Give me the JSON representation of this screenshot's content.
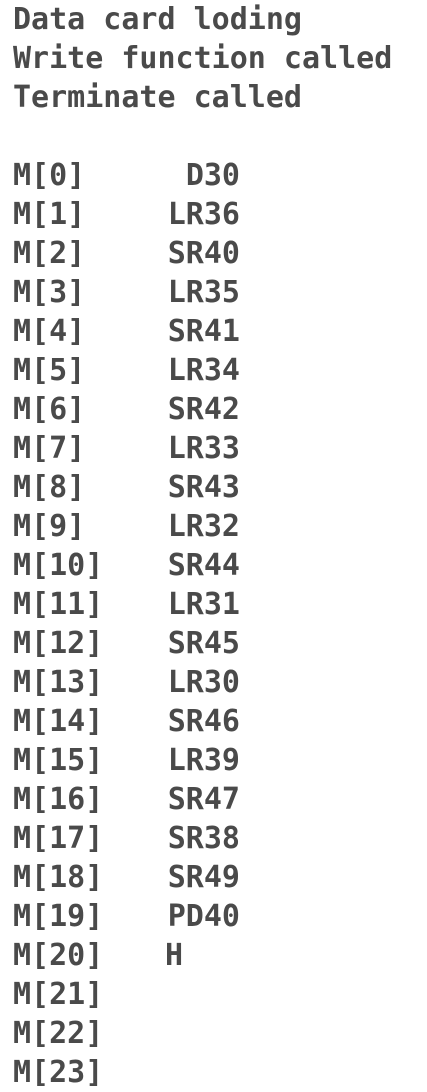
{
  "messages": [
    "Data card loding",
    "Write function called",
    "Terminate called"
  ],
  "memory": [
    {
      "addr": "M[0]",
      "value": "D30"
    },
    {
      "addr": "M[1]",
      "value": "LR36"
    },
    {
      "addr": "M[2]",
      "value": "SR40"
    },
    {
      "addr": "M[3]",
      "value": "LR35"
    },
    {
      "addr": "M[4]",
      "value": "SR41"
    },
    {
      "addr": "M[5]",
      "value": "LR34"
    },
    {
      "addr": "M[6]",
      "value": "SR42"
    },
    {
      "addr": "M[7]",
      "value": "LR33"
    },
    {
      "addr": "M[8]",
      "value": "SR43"
    },
    {
      "addr": "M[9]",
      "value": "LR32"
    },
    {
      "addr": "M[10]",
      "value": "SR44"
    },
    {
      "addr": "M[11]",
      "value": "LR31"
    },
    {
      "addr": "M[12]",
      "value": "SR45"
    },
    {
      "addr": "M[13]",
      "value": "LR30"
    },
    {
      "addr": "M[14]",
      "value": "SR46"
    },
    {
      "addr": "M[15]",
      "value": "LR39"
    },
    {
      "addr": "M[16]",
      "value": "SR47"
    },
    {
      "addr": "M[17]",
      "value": "SR38"
    },
    {
      "addr": "M[18]",
      "value": "SR49"
    },
    {
      "addr": "M[19]",
      "value": "PD40"
    },
    {
      "addr": "M[20]",
      "value": "H"
    },
    {
      "addr": "M[21]",
      "value": ""
    },
    {
      "addr": "M[22]",
      "value": ""
    },
    {
      "addr": "M[23]",
      "value": ""
    }
  ]
}
